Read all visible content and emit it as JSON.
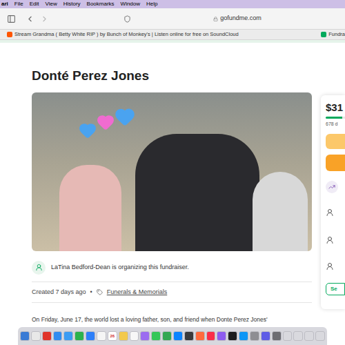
{
  "menu_bar": {
    "app": "ari",
    "items": [
      "File",
      "Edit",
      "View",
      "History",
      "Bookmarks",
      "Window",
      "Help"
    ]
  },
  "toolbar": {
    "address": "gofundme.com"
  },
  "favorites": [
    {
      "label": "Stream Grandma ( Betty White RIP ) by Bunch of Monkey's | Listen online for free on SoundCloud",
      "color": "#ff5500"
    },
    {
      "label": "Fundra",
      "color": "#02a95c"
    }
  ],
  "page": {
    "title": "Donté Perez Jones",
    "organizer": "LaTina Bedford-Dean is organizing this fundraiser.",
    "created": "Created 7 days ago",
    "separator": "•",
    "category": "Funerals & Memorials",
    "story": "On Friday, June 17, the world lost a loving father, son, and friend when Donte Perez Jones'"
  },
  "donation_panel": {
    "amount": "$31",
    "donations": "678 d",
    "level": 0.85,
    "button": "Se"
  },
  "dock": {
    "calendar_date": "26",
    "items": [
      {
        "color": "#3a7bd5"
      },
      {
        "color": "#e8e8e8"
      },
      {
        "color": "#e0342b"
      },
      {
        "color": "#2f8cf0"
      },
      {
        "color": "#3b9cf3"
      },
      {
        "color": "#2bb24c"
      },
      {
        "color": "#2d7ff9"
      },
      {
        "color": "#f5f5f5"
      },
      {
        "color": "#ffffff"
      },
      {
        "color": "#f2c94c"
      },
      {
        "color": "#f7f7f7"
      },
      {
        "color": "#9b6cf0"
      },
      {
        "color": "#34c759"
      },
      {
        "color": "#34a853"
      },
      {
        "color": "#0a84ff"
      },
      {
        "color": "#3a3a3c"
      },
      {
        "color": "#ff6a3d"
      },
      {
        "color": "#fa2d48"
      },
      {
        "color": "#8e5cf0"
      },
      {
        "color": "#1c1c1e"
      },
      {
        "color": "#0d96f6"
      },
      {
        "color": "#8e8e93"
      },
      {
        "color": "#5e5ce6"
      },
      {
        "color": "#6d6d72"
      },
      {
        "color": "#d9d9de"
      },
      {
        "color": "#d9d9de"
      },
      {
        "color": "#d9d9de"
      },
      {
        "color": "#d9d9de"
      }
    ]
  }
}
